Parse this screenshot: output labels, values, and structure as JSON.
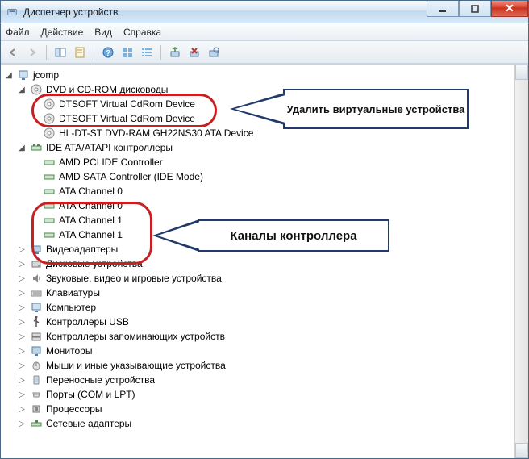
{
  "window": {
    "title": "Диспетчер устройств"
  },
  "menubar": {
    "file": "Файл",
    "action": "Действие",
    "view": "Вид",
    "help": "Справка"
  },
  "tree": {
    "root": "jcomp",
    "dvd_group": "DVD и CD-ROM дисководы",
    "dvd_items": {
      "0": "DTSOFT Virtual CdRom Device",
      "1": "DTSOFT Virtual CdRom Device",
      "2": "HL-DT-ST DVD-RAM GH22NS30 ATA Device"
    },
    "ide_group": "IDE ATA/ATAPI контроллеры",
    "ide_items": {
      "0": "AMD PCI IDE Controller",
      "1": "AMD SATA Controller (IDE Mode)",
      "2": "ATA Channel 0",
      "3": "ATA Channel 0",
      "4": "ATA Channel 1",
      "5": "ATA Channel 1"
    },
    "video": "Видеоадаптеры",
    "disk": "Дисковые устройства",
    "sound": "Звуковые, видео и игровые устройства",
    "keyboard": "Клавиатуры",
    "computer": "Компьютер",
    "usb": "Контроллеры USB",
    "storage_ctrl": "Контроллеры запоминающих устройств",
    "monitors": "Мониторы",
    "mice": "Мыши и иные указывающие устройства",
    "portable": "Переносные устройства",
    "ports": "Порты (COM и LPT)",
    "processors": "Процессоры",
    "network": "Сетевые адаптеры"
  },
  "callouts": {
    "delete_virtual": "Удалить виртуальные устройства",
    "controller_channels": "Каналы контроллера"
  }
}
